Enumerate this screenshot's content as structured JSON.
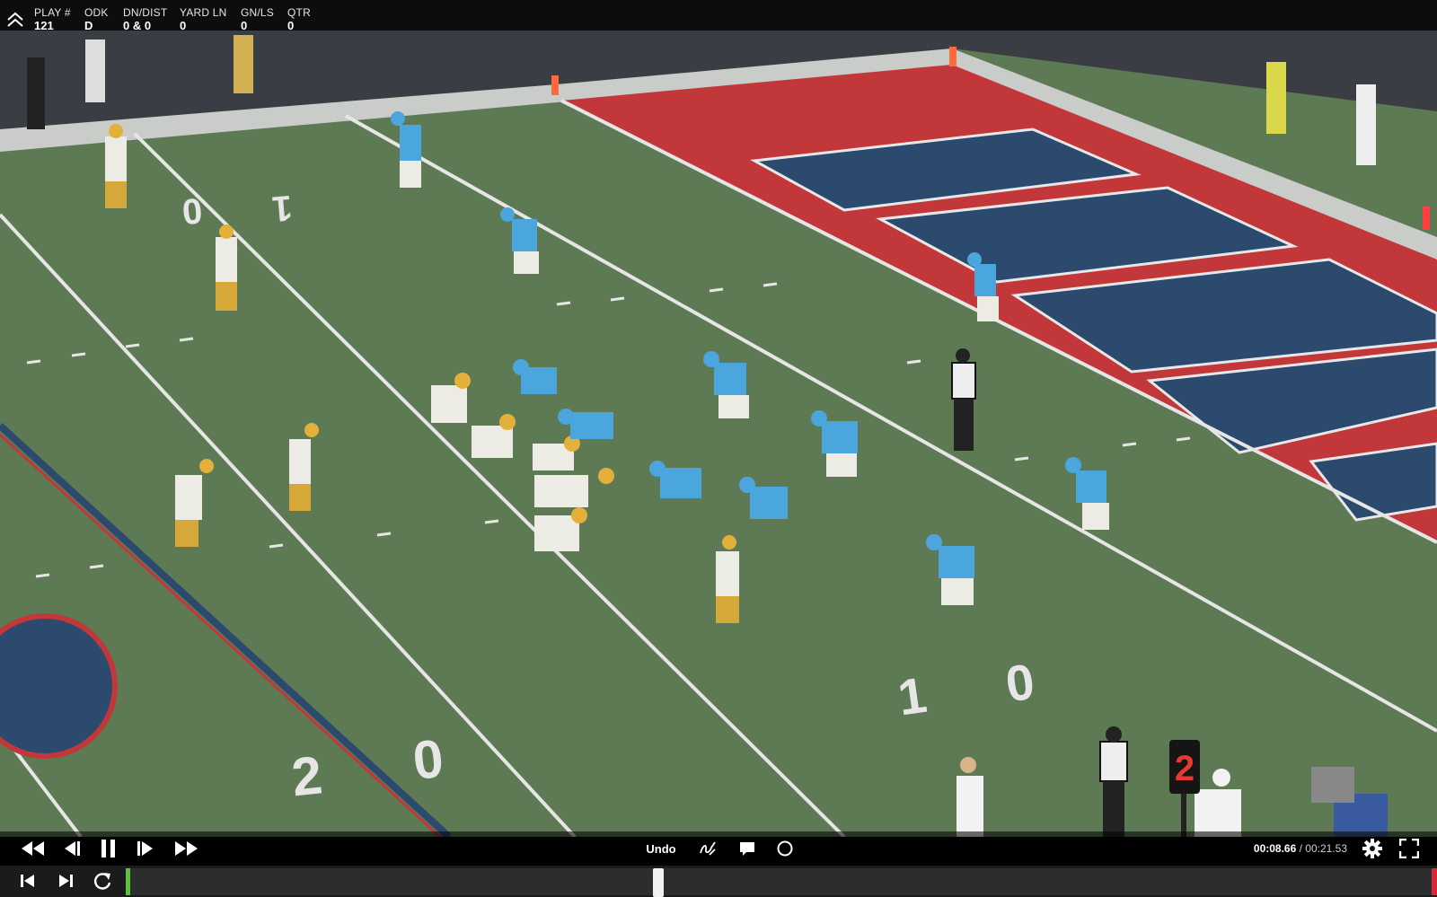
{
  "info_bar": {
    "fields": [
      {
        "label": "PLAY #",
        "value": "121"
      },
      {
        "label": "ODK",
        "value": "D"
      },
      {
        "label": "DN/DIST",
        "value": "0 & 0"
      },
      {
        "label": "YARD LN",
        "value": "0"
      },
      {
        "label": "GN/LS",
        "value": "0"
      },
      {
        "label": "QTR",
        "value": "0"
      }
    ]
  },
  "field_markings": {
    "yard_ten_one": "1",
    "yard_ten_zero": "0",
    "yard_twenty_two": "2",
    "yard_twenty_zero": "0",
    "yard_ten_far_one": "1",
    "yard_ten_far_zero": "0",
    "down_marker": "2"
  },
  "controls": {
    "undo_label": "Undo",
    "current_time": "00:08.66",
    "separator": " / ",
    "total_time": "00:21.53"
  },
  "timeline": {
    "progress": 0.402
  },
  "colors": {
    "field_green": "#5f7a55",
    "endzone_red": "#c2383a",
    "endzone_letter_navy": "#2b4a6e",
    "away_jersey_white": "#ecebe4",
    "away_helmet_gold": "#e3b13a",
    "home_jersey_blue": "#4aa6dd",
    "timeline_start": "#5cc23c",
    "timeline_end": "#d6283a"
  }
}
